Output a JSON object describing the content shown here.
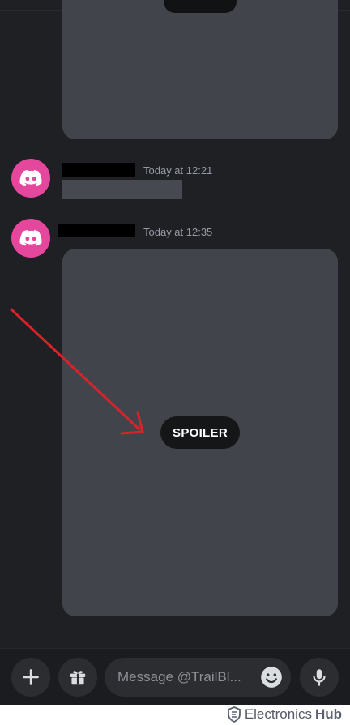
{
  "messages": [
    {
      "timestamp": "Today at 12:21"
    },
    {
      "timestamp": "Today at 12:35",
      "spoiler_label": "SPOILER"
    }
  ],
  "composer": {
    "placeholder": "Message @TrailBl..."
  },
  "icons": {
    "avatar": "discord-logo-icon",
    "add": "plus-icon",
    "gift": "gift-icon",
    "emoji": "smiley-icon",
    "mic": "microphone-icon"
  },
  "colors": {
    "background": "#1f2023",
    "avatar": "#e5479d",
    "attachment": "#42444b",
    "spoiler_pill": "#151618",
    "annotation_arrow": "#d9232a"
  },
  "watermark": {
    "name": "Electronics",
    "name_strong": "Hub"
  }
}
